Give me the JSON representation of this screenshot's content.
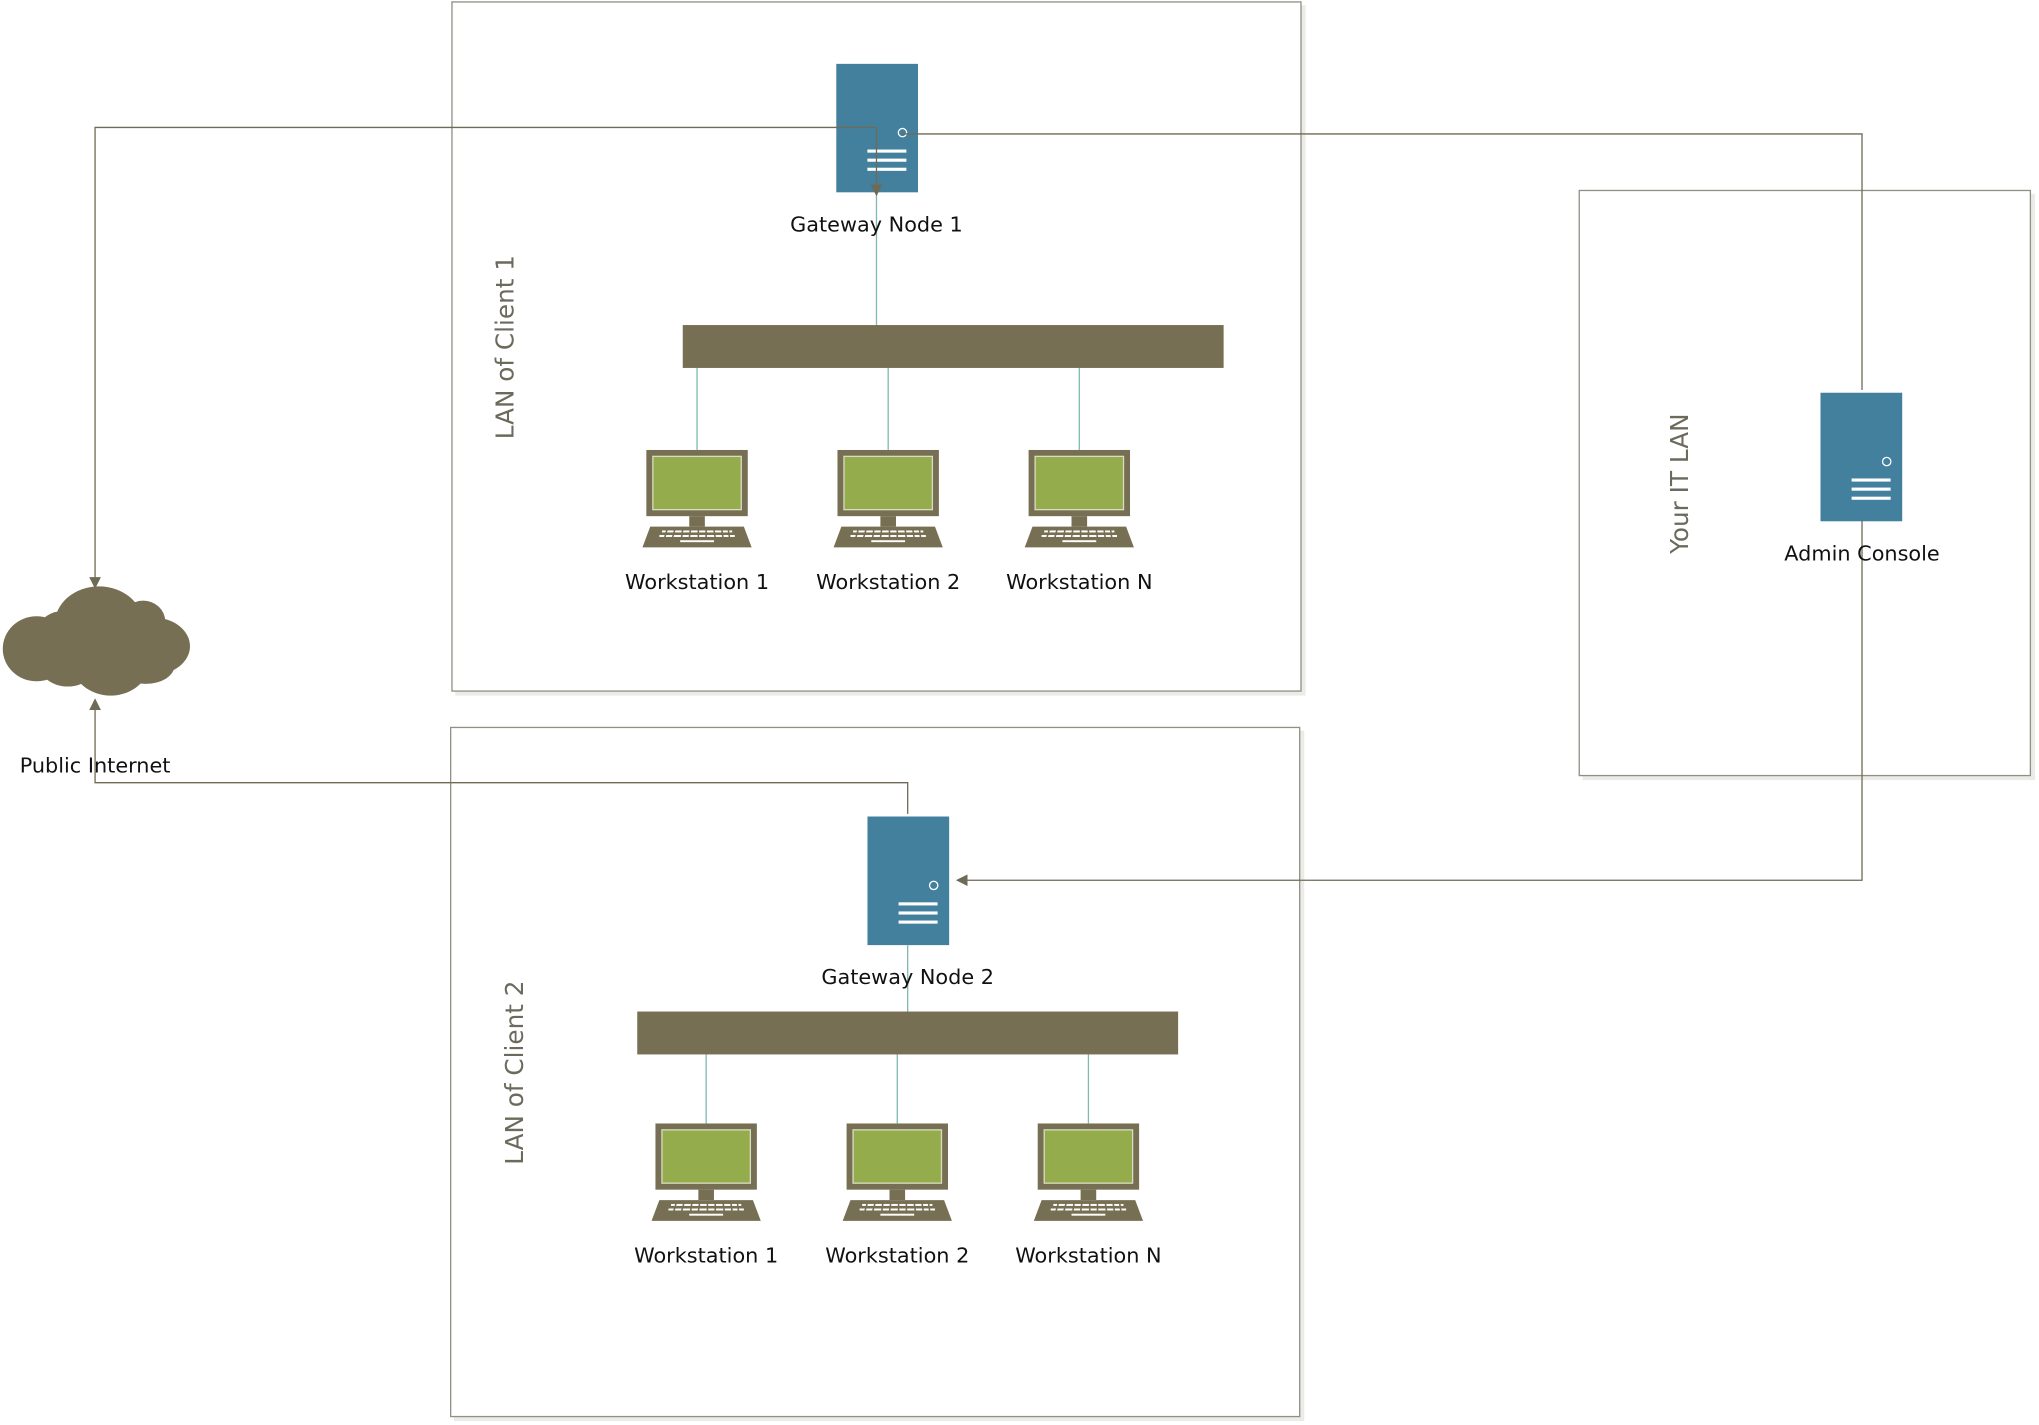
{
  "diagram": {
    "zones": {
      "client1": "LAN of Client 1",
      "client2": "LAN of Client 2",
      "it": "Your IT LAN"
    },
    "nodes": {
      "gateway1": "Gateway Node 1",
      "gateway2": "Gateway Node 2",
      "admin": "Admin Console",
      "internet": "Public Internet"
    },
    "client1_workstations": [
      "Workstation 1",
      "Workstation 2",
      "Workstation N"
    ],
    "client2_workstations": [
      "Workstation 1",
      "Workstation 2",
      "Workstation N"
    ],
    "icons": {
      "server": "server-icon",
      "workstation": "workstation-icon",
      "cloud": "cloud-icon",
      "switch": "network-switch-bar"
    },
    "colors": {
      "server": "#42809e",
      "switch": "#776f53",
      "screen": "#94ac4c",
      "connector": "#6f6a55",
      "lan_link": "#7fb8ad"
    }
  }
}
